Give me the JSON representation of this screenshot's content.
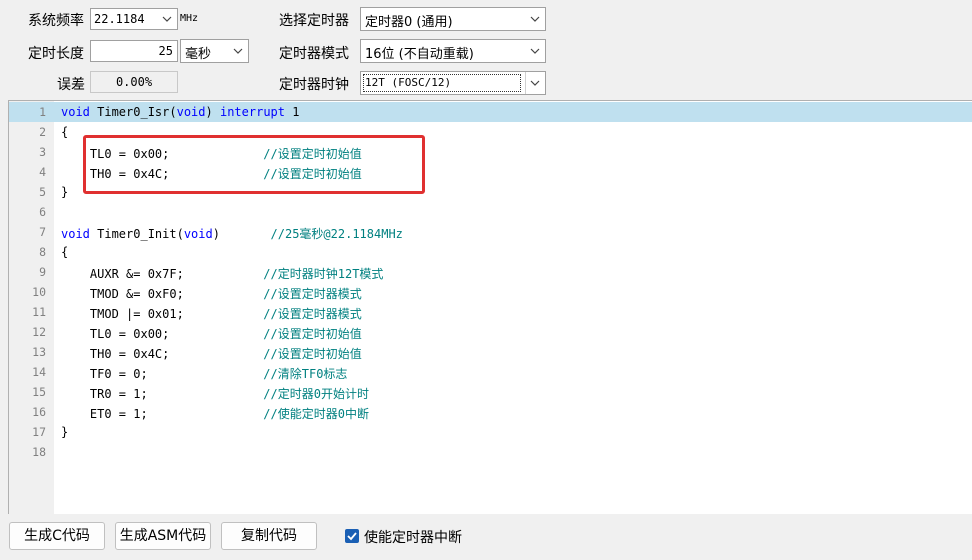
{
  "settings": {
    "sys_freq_label": "系统频率",
    "sys_freq_value": "22.1184",
    "sys_freq_unit": "MHz",
    "timer_len_label": "定时长度",
    "timer_len_value": "25",
    "timer_len_unit": "毫秒",
    "error_label": "误差",
    "error_value": "0.00%",
    "select_timer_label": "选择定时器",
    "select_timer_value": "定时器0 (通用)",
    "timer_mode_label": "定时器模式",
    "timer_mode_value": "16位 (不自动重载)",
    "timer_clock_label": "定时器时钟",
    "timer_clock_value": "12T (FOSC/12)"
  },
  "code_lines": [
    {
      "n": "1",
      "segs": [
        {
          "t": "void",
          "c": "kw"
        },
        {
          "t": " Timer0_Isr(",
          "c": ""
        },
        {
          "t": "void",
          "c": "kw"
        },
        {
          "t": ") ",
          "c": ""
        },
        {
          "t": "interrupt",
          "c": "kw"
        },
        {
          "t": " 1",
          "c": ""
        }
      ]
    },
    {
      "n": "2",
      "segs": [
        {
          "t": "{",
          "c": ""
        }
      ]
    },
    {
      "n": "3",
      "segs": [
        {
          "t": "    TL0 = 0x00;             ",
          "c": ""
        },
        {
          "t": "//设置定时初始值",
          "c": "cm"
        }
      ]
    },
    {
      "n": "4",
      "segs": [
        {
          "t": "    TH0 = 0x4C;             ",
          "c": ""
        },
        {
          "t": "//设置定时初始值",
          "c": "cm"
        }
      ]
    },
    {
      "n": "5",
      "segs": [
        {
          "t": "}",
          "c": ""
        }
      ]
    },
    {
      "n": "6",
      "segs": []
    },
    {
      "n": "7",
      "segs": [
        {
          "t": "void",
          "c": "kw"
        },
        {
          "t": " Timer0_Init(",
          "c": ""
        },
        {
          "t": "void",
          "c": "kw"
        },
        {
          "t": ")       ",
          "c": ""
        },
        {
          "t": "//25毫秒@22.1184MHz",
          "c": "cm"
        }
      ]
    },
    {
      "n": "8",
      "segs": [
        {
          "t": "{",
          "c": ""
        }
      ]
    },
    {
      "n": "9",
      "segs": [
        {
          "t": "    AUXR &= 0x7F;           ",
          "c": ""
        },
        {
          "t": "//定时器时钟12T模式",
          "c": "cm"
        }
      ]
    },
    {
      "n": "10",
      "segs": [
        {
          "t": "    TMOD &= 0xF0;           ",
          "c": ""
        },
        {
          "t": "//设置定时器模式",
          "c": "cm"
        }
      ]
    },
    {
      "n": "11",
      "segs": [
        {
          "t": "    TMOD |= 0x01;           ",
          "c": ""
        },
        {
          "t": "//设置定时器模式",
          "c": "cm"
        }
      ]
    },
    {
      "n": "12",
      "segs": [
        {
          "t": "    TL0 = 0x00;             ",
          "c": ""
        },
        {
          "t": "//设置定时初始值",
          "c": "cm"
        }
      ]
    },
    {
      "n": "13",
      "segs": [
        {
          "t": "    TH0 = 0x4C;             ",
          "c": ""
        },
        {
          "t": "//设置定时初始值",
          "c": "cm"
        }
      ]
    },
    {
      "n": "14",
      "segs": [
        {
          "t": "    TF0 = 0;                ",
          "c": ""
        },
        {
          "t": "//清除TF0标志",
          "c": "cm"
        }
      ]
    },
    {
      "n": "15",
      "segs": [
        {
          "t": "    TR0 = 1;                ",
          "c": ""
        },
        {
          "t": "//定时器0开始计时",
          "c": "cm"
        }
      ]
    },
    {
      "n": "16",
      "segs": [
        {
          "t": "    ET0 = 1;                ",
          "c": ""
        },
        {
          "t": "//使能定时器0中断",
          "c": "cm"
        }
      ]
    },
    {
      "n": "17",
      "segs": [
        {
          "t": "}",
          "c": ""
        }
      ]
    },
    {
      "n": "18",
      "segs": []
    }
  ],
  "highlighted_line": "1",
  "buttons": {
    "gen_c": "生成C代码",
    "gen_asm": "生成ASM代码",
    "copy": "复制代码"
  },
  "enable_interrupt": {
    "label": "使能定时器中断",
    "checked": true
  },
  "colors": {
    "keyword": "#0000ff",
    "comment": "#008080",
    "highlight": "#bfe0ef",
    "annotation_box": "#e03030",
    "checkbox": "#1a5fb4"
  }
}
